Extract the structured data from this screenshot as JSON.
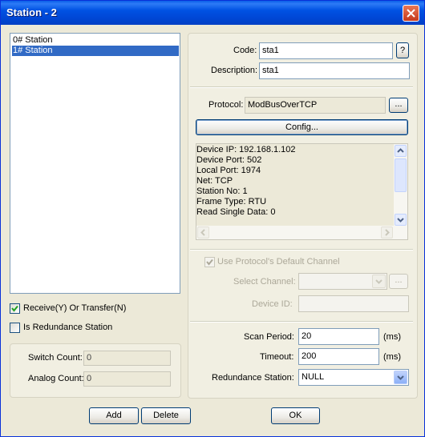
{
  "window": {
    "title": "Station - 2"
  },
  "stations": {
    "items": [
      {
        "label": "0# Station",
        "selected": false
      },
      {
        "label": "1# Station",
        "selected": true
      }
    ]
  },
  "left_options": {
    "receive_label": "Receive(Y) Or Transfer(N)",
    "receive_checked": true,
    "redundancy_label": "Is Redundance Station",
    "redundancy_checked": false
  },
  "counts": {
    "switch_label": "Switch Count:",
    "switch_value": "0",
    "analog_label": "Analog Count:",
    "analog_value": "0"
  },
  "identity": {
    "code_label": "Code:",
    "code_value": "sta1",
    "help_label": "?",
    "description_label": "Description:",
    "description_value": "sta1"
  },
  "protocol": {
    "label": "Protocol:",
    "value": "ModBusOverTCP",
    "browse_label": "...",
    "config_label": "Config...",
    "info_lines": [
      "Device IP: 192.168.1.102",
      "Device Port: 502",
      "Local Port: 1974",
      "Net: TCP",
      "Station No: 1",
      "Frame Type: RTU",
      "Read Single Data: 0"
    ]
  },
  "channel": {
    "use_default_label": "Use Protocol's Default Channel",
    "use_default_checked": true,
    "select_label": "Select Channel:",
    "select_value": "",
    "select_browse_label": "...",
    "device_id_label": "Device ID:",
    "device_id_value": ""
  },
  "scan": {
    "period_label": "Scan Period:",
    "period_value": "20",
    "period_unit": "(ms)",
    "timeout_label": "Timeout:",
    "timeout_value": "200",
    "timeout_unit": "(ms)",
    "redundance_label": "Redundance Station:",
    "redundance_value": "NULL"
  },
  "buttons": {
    "add": "Add",
    "delete": "Delete",
    "ok": "OK"
  },
  "colors": {
    "titlebar": "#0054e3",
    "selection": "#316ac5",
    "face": "#ece9d8"
  }
}
